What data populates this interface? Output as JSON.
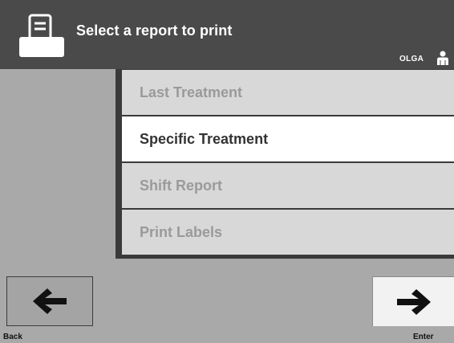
{
  "header": {
    "title": "Select a report to print",
    "user": "OLGA",
    "icon": "printer-icon",
    "user_icon": "user-icon"
  },
  "menu": {
    "items": [
      {
        "label": "Last Treatment",
        "enabled": false
      },
      {
        "label": "Specific Treatment",
        "enabled": true
      },
      {
        "label": "Shift Report",
        "enabled": false
      },
      {
        "label": "Print Labels",
        "enabled": false
      }
    ]
  },
  "nav": {
    "back_label": "Back",
    "enter_label": "Enter",
    "back_icon": "arrow-left-icon",
    "enter_icon": "arrow-right-icon"
  },
  "colors": {
    "header_bg": "#4a4a4a",
    "screen_bg": "#a9a9a9",
    "item_enabled_bg": "#ffffff",
    "item_disabled_bg": "#d8d8d8"
  }
}
